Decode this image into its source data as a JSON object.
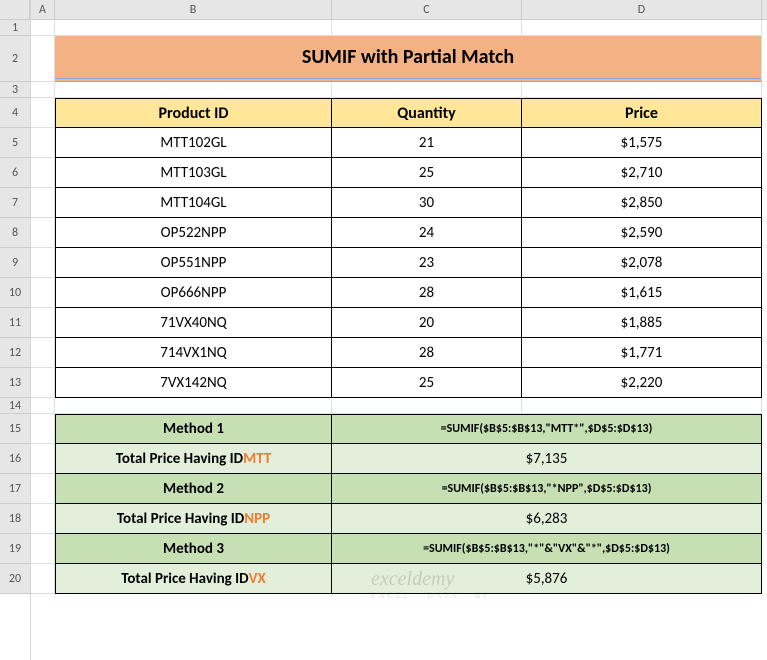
{
  "columns": [
    "A",
    "B",
    "C",
    "D"
  ],
  "rows": [
    "1",
    "2",
    "3",
    "4",
    "5",
    "6",
    "7",
    "8",
    "9",
    "10",
    "11",
    "12",
    "13",
    "14",
    "15",
    "16",
    "17",
    "18",
    "19",
    "20"
  ],
  "row_heights": {
    "1": 16,
    "2": 46,
    "3": 16,
    "4": 30,
    "5": 30,
    "6": 30,
    "7": 30,
    "8": 30,
    "9": 30,
    "10": 30,
    "11": 30,
    "12": 30,
    "13": 30,
    "14": 16,
    "15": 30,
    "16": 30,
    "17": 30,
    "18": 30,
    "19": 30,
    "20": 30
  },
  "title": "SUMIF with Partial Match",
  "table_headers": {
    "product_id": "Product ID",
    "quantity": "Quantity",
    "price": "Price"
  },
  "data": [
    {
      "product_id": "MTT102GL",
      "quantity": "21",
      "price": "$1,575"
    },
    {
      "product_id": "MTT103GL",
      "quantity": "25",
      "price": "$2,710"
    },
    {
      "product_id": "MTT104GL",
      "quantity": "30",
      "price": "$2,850"
    },
    {
      "product_id": "OP522NPP",
      "quantity": "24",
      "price": "$2,590"
    },
    {
      "product_id": "OP551NPP",
      "quantity": "23",
      "price": "$2,078"
    },
    {
      "product_id": "OP666NPP",
      "quantity": "28",
      "price": "$1,615"
    },
    {
      "product_id": "71VX40NQ",
      "quantity": "20",
      "price": "$1,885"
    },
    {
      "product_id": "714VX1NQ",
      "quantity": "28",
      "price": "$1,771"
    },
    {
      "product_id": "7VX142NQ",
      "quantity": "25",
      "price": "$2,220"
    }
  ],
  "methods": [
    {
      "label": "Method 1",
      "formula": "=SUMIF($B$5:$B$13,\"MTT*\",$D$5:$D$13)",
      "result_label_prefix": "Total Price Having ID ",
      "result_label_highlight": "MTT",
      "result_value": "$7,135"
    },
    {
      "label": "Method 2",
      "formula": "=SUMIF($B$5:$B$13,\"*NPP\",$D$5:$D$13)",
      "result_label_prefix": "Total Price Having ID ",
      "result_label_highlight": "NPP",
      "result_value": "$6,283"
    },
    {
      "label": "Method 3",
      "formula": "=SUMIF($B$5:$B$13,\"*\"&\"VX\"&\"*\",$D$5:$D$13)",
      "result_label_prefix": "Total Price Having ID ",
      "result_label_highlight": "VX",
      "result_value": "$5,876"
    }
  ],
  "watermark": {
    "main": "exceldemy",
    "sub": "EXCEL · DATA · BI"
  },
  "chart_data": {
    "type": "table",
    "title": "SUMIF with Partial Match",
    "columns": [
      "Product ID",
      "Quantity",
      "Price"
    ],
    "rows": [
      [
        "MTT102GL",
        21,
        1575
      ],
      [
        "MTT103GL",
        25,
        2710
      ],
      [
        "MTT104GL",
        30,
        2850
      ],
      [
        "OP522NPP",
        24,
        2590
      ],
      [
        "OP551NPP",
        23,
        2078
      ],
      [
        "OP666NPP",
        28,
        1615
      ],
      [
        "71VX40NQ",
        20,
        1885
      ],
      [
        "714VX1NQ",
        28,
        1771
      ],
      [
        "7VX142NQ",
        25,
        2220
      ]
    ],
    "summary": [
      {
        "method": "Method 1",
        "criteria": "MTT*",
        "total": 7135
      },
      {
        "method": "Method 2",
        "criteria": "*NPP",
        "total": 6283
      },
      {
        "method": "Method 3",
        "criteria": "*VX*",
        "total": 5876
      }
    ]
  }
}
